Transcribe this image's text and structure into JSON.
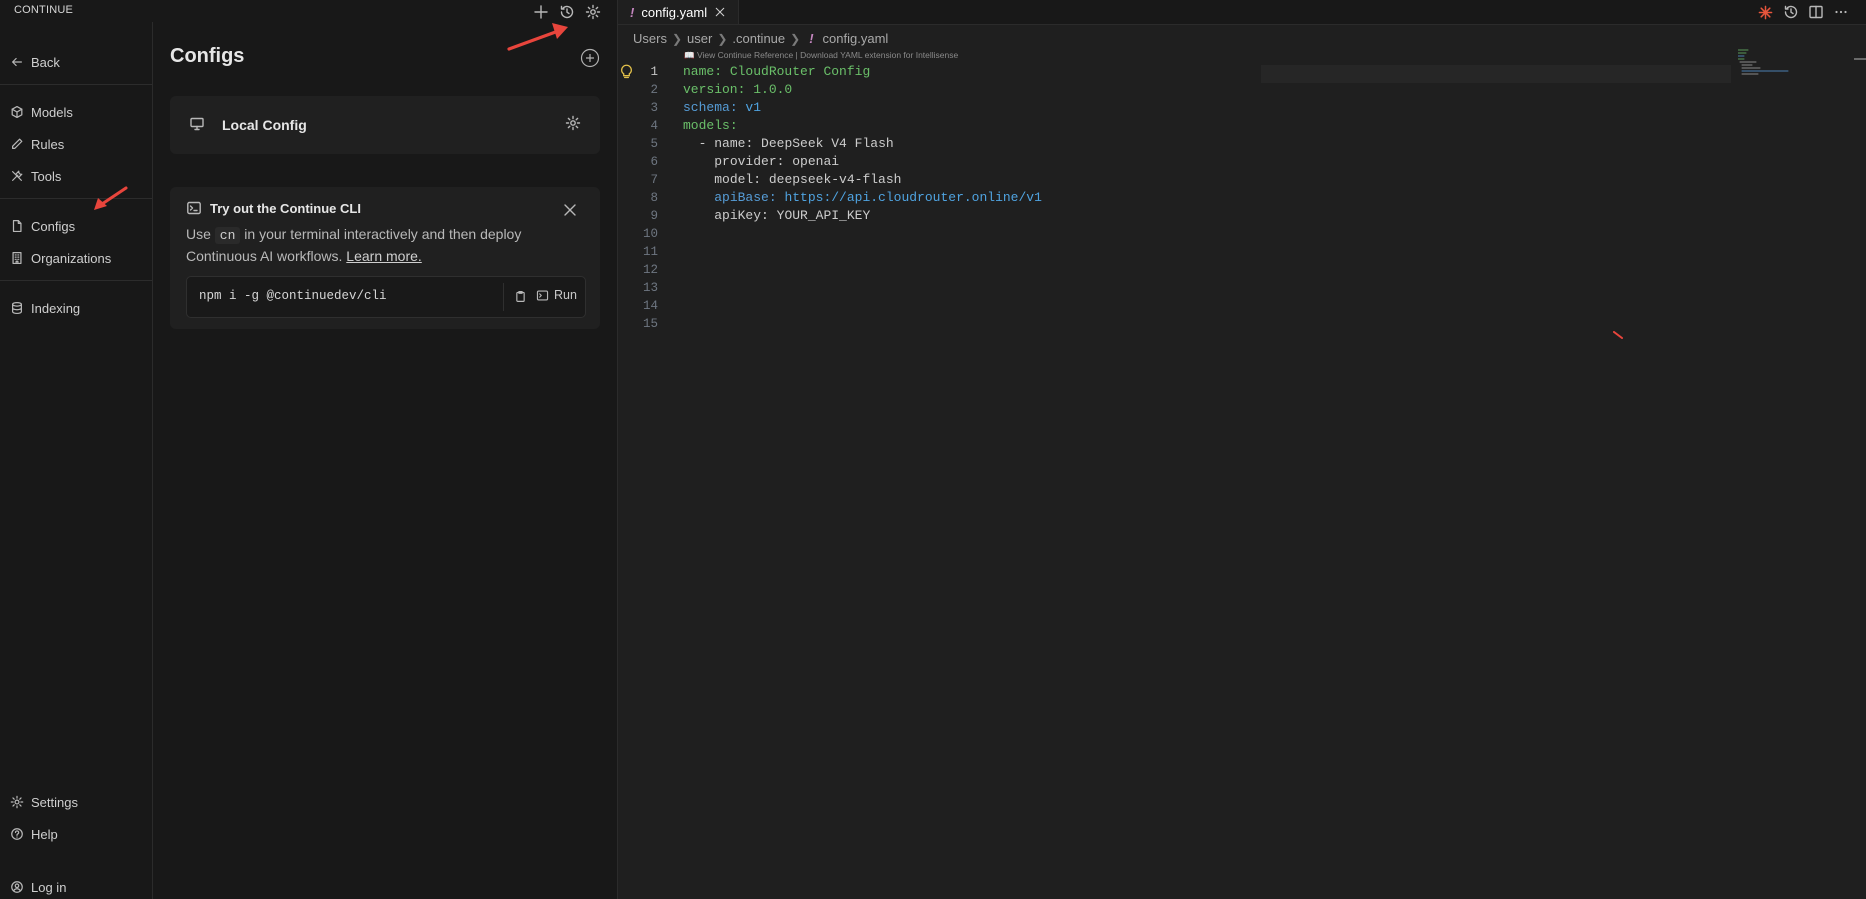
{
  "panel": {
    "title": "CONTINUE",
    "header_icons": [
      "plus-icon",
      "history-icon",
      "gear-icon"
    ]
  },
  "nav": {
    "back": "Back",
    "items": [
      {
        "label": "Models",
        "icon": "cube-icon"
      },
      {
        "label": "Rules",
        "icon": "pencil-icon"
      },
      {
        "label": "Tools",
        "icon": "tools-icon"
      },
      {
        "label": "Configs",
        "icon": "file-icon"
      },
      {
        "label": "Organizations",
        "icon": "building-icon"
      },
      {
        "label": "Indexing",
        "icon": "database-icon"
      }
    ],
    "bottom": [
      {
        "label": "Settings",
        "icon": "gear-icon"
      },
      {
        "label": "Help",
        "icon": "help-icon"
      },
      {
        "label": "Log in",
        "icon": "user-icon"
      }
    ]
  },
  "configs": {
    "title": "Configs",
    "local_config": "Local Config"
  },
  "cli_card": {
    "title": "Try out the Continue CLI",
    "desc_pre": "Use",
    "desc_code": "cn",
    "desc_post": "in your terminal interactively and then deploy Continuous AI workflows.",
    "learn_more": "Learn more.",
    "command": "npm i -g @continuedev/cli",
    "run_label": "Run"
  },
  "editor": {
    "tab_marker": "!",
    "tab_label": "config.yaml",
    "breadcrumb": [
      "Users",
      "user",
      ".continue",
      "config.yaml"
    ],
    "codelens": "📖 View Continue Reference | Download YAML extension for Intellisense",
    "line_numbers": [
      "1",
      "2",
      "3",
      "4",
      "5",
      "6",
      "7",
      "8",
      "9",
      "10",
      "11",
      "12",
      "13",
      "14",
      "15"
    ],
    "active_line": 1,
    "code_lines": [
      {
        "indent": "",
        "key": "name",
        "sep": ": ",
        "value": "CloudRouter Config"
      },
      {
        "indent": "",
        "key": "version",
        "sep": ": ",
        "value": "1.0.0"
      },
      {
        "indent": "",
        "key": "schema",
        "sep": ": ",
        "value": "v1"
      },
      {
        "indent": "",
        "key": "models",
        "sep": ":",
        "value": ""
      },
      {
        "indent": "  - ",
        "key": "name",
        "sep": ": ",
        "value": "DeepSeek V4 Flash"
      },
      {
        "indent": "    ",
        "key": "provider",
        "sep": ": ",
        "value": "openai"
      },
      {
        "indent": "    ",
        "key": "model",
        "sep": ": ",
        "value": "deepseek-v4-flash"
      },
      {
        "indent": "    ",
        "key": "apiBase",
        "sep": ": ",
        "value": "https://api.cloudrouter.online/v1"
      },
      {
        "indent": "    ",
        "key": "apiKey",
        "sep": ": ",
        "value": "YOUR_API_KEY"
      }
    ]
  }
}
